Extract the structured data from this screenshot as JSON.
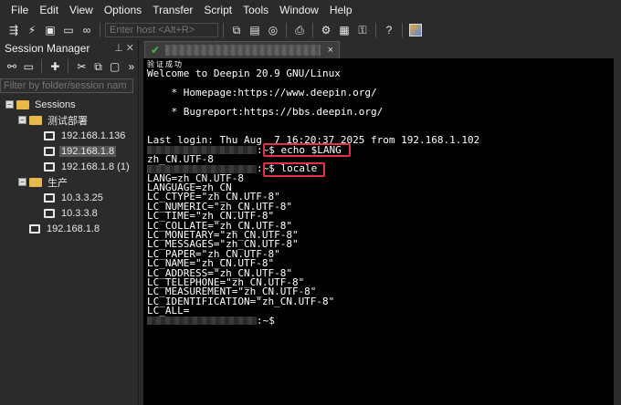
{
  "menu": [
    "File",
    "Edit",
    "View",
    "Options",
    "Transfer",
    "Script",
    "Tools",
    "Window",
    "Help"
  ],
  "toolbar": {
    "host_placeholder": "Enter host <Alt+R>",
    "icons": [
      "connect-icon",
      "lightning-icon",
      "terminal-icon",
      "reconnect-icon",
      "link-icon",
      "copy-icon",
      "paste-icon",
      "find-icon",
      "print-icon",
      "settings-icon",
      "keymap-icon",
      "key-icon",
      "help-icon",
      "sftp-icon"
    ]
  },
  "session_manager": {
    "title": "Session Manager",
    "filter_placeholder": "Filter by folder/session nam",
    "tree": {
      "root": "Sessions",
      "groups": [
        {
          "name": "测试部署",
          "items": [
            "192.168.1.136",
            "192.168.1.8",
            "192.168.1.8 (1)"
          ],
          "selected": "192.168.1.8"
        },
        {
          "name": "生产",
          "items": [
            "10.3.3.25",
            "10.3.3.8"
          ]
        }
      ],
      "loose": [
        "192.168.1.8"
      ]
    }
  },
  "tab": {
    "close": "×"
  },
  "terminal": {
    "lines": [
      "验证成功",
      "Welcome to Deepin 20.9 GNU/Linux",
      "",
      "    * Homepage:https://www.deepin.org/",
      "",
      "    * Bugreport:https://bbs.deepin.org/",
      "",
      "",
      "Last login: Thu Aug  7 16:20:37 2025 from 192.168.1.102",
      ":~$ echo $LANG",
      "zh_CN.UTF-8",
      ":~$ locale",
      "LANG=zh_CN.UTF-8",
      "LANGUAGE=zh_CN",
      "LC_CTYPE=\"zh_CN.UTF-8\"",
      "LC_NUMERIC=\"zh_CN.UTF-8\"",
      "LC_TIME=\"zh_CN.UTF-8\"",
      "LC_COLLATE=\"zh_CN.UTF-8\"",
      "LC_MONETARY=\"zh_CN.UTF-8\"",
      "LC_MESSAGES=\"zh_CN.UTF-8\"",
      "LC_PAPER=\"zh_CN.UTF-8\"",
      "LC_NAME=\"zh_CN.UTF-8\"",
      "LC_ADDRESS=\"zh_CN.UTF-8\"",
      "LC_TELEPHONE=\"zh_CN.UTF-8\"",
      "LC_MEASUREMENT=\"zh_CN.UTF-8\"",
      "LC_IDENTIFICATION=\"zh_CN.UTF-8\"",
      "LC_ALL=",
      ":~$"
    ]
  }
}
